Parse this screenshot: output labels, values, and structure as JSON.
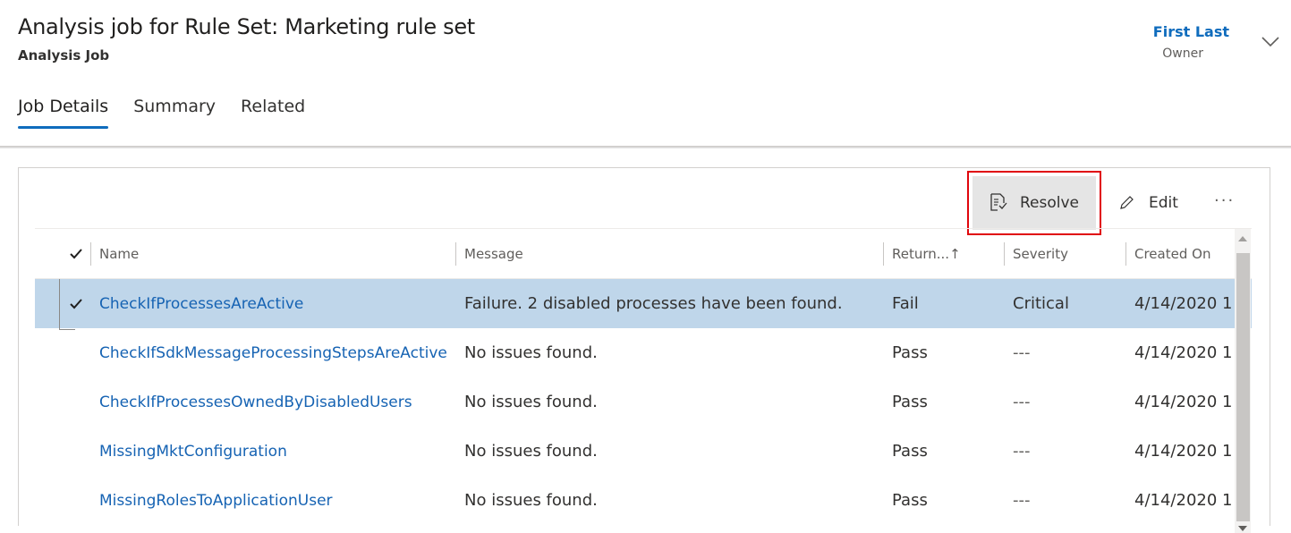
{
  "header": {
    "title": "Analysis job for Rule Set: Marketing rule set",
    "subtitle": "Analysis Job",
    "owner_name": "First Last",
    "owner_label": "Owner"
  },
  "tabs": [
    {
      "label": "Job Details",
      "active": true
    },
    {
      "label": "Summary",
      "active": false
    },
    {
      "label": "Related",
      "active": false
    }
  ],
  "toolbar": {
    "resolve_label": "Resolve",
    "edit_label": "Edit",
    "more_label": "···"
  },
  "grid": {
    "columns": [
      "Name",
      "Message",
      "Return...↑",
      "Severity",
      "Created On"
    ],
    "rows": [
      {
        "name": "CheckIfProcessesAreActive",
        "message": "Failure. 2 disabled processes have been found.",
        "return": "Fail",
        "severity": "Critical",
        "created": "4/14/2020 1",
        "selected": true
      },
      {
        "name": "CheckIfSdkMessageProcessingStepsAreActive",
        "message": "No issues found.",
        "return": "Pass",
        "severity": "---",
        "created": "4/14/2020 1",
        "selected": false
      },
      {
        "name": "CheckIfProcessesOwnedByDisabledUsers",
        "message": "No issues found.",
        "return": "Pass",
        "severity": "---",
        "created": "4/14/2020 1",
        "selected": false
      },
      {
        "name": "MissingMktConfiguration",
        "message": "No issues found.",
        "return": "Pass",
        "severity": "---",
        "created": "4/14/2020 1",
        "selected": false
      },
      {
        "name": "MissingRolesToApplicationUser",
        "message": "No issues found.",
        "return": "Pass",
        "severity": "---",
        "created": "4/14/2020 1",
        "selected": false
      }
    ]
  },
  "colors": {
    "accent": "#0f6cbd",
    "link": "#1663b3",
    "selected_row": "#bfd6ea",
    "highlight_border": "#e0060c"
  }
}
